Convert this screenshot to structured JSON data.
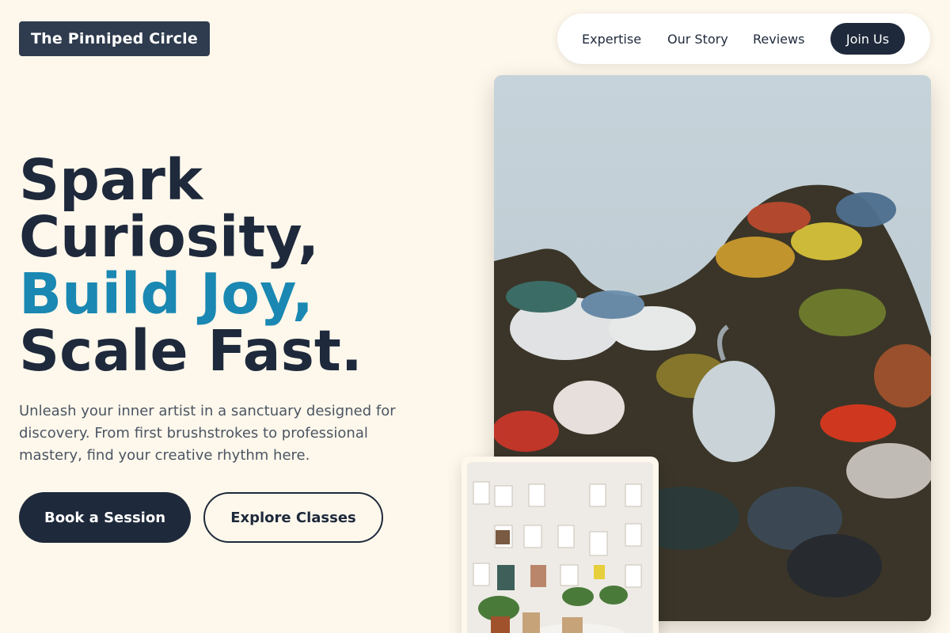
{
  "brand": {
    "name": "The Pinniped Circle"
  },
  "nav": {
    "links": [
      "Expertise",
      "Our Story",
      "Reviews"
    ],
    "cta": "Join Us"
  },
  "hero": {
    "title_line1": "Spark",
    "title_line2": "Curiosity,",
    "title_line3": "Build Joy,",
    "title_line4": "Scale Fast.",
    "subtitle": "Unleash your inner artist in a sanctuary designed for discovery. From first brushstrokes to professional mastery, find your creative rhythm here.",
    "primary_button": "Book a Session",
    "secondary_button": "Explore Classes"
  },
  "images": {
    "main": "paint-palette-photo",
    "secondary": "art-wall-studio-photo"
  },
  "colors": {
    "background": "#fef8ec",
    "navy": "#1e293b",
    "accent": "#1a88b2",
    "logo_bg": "#2f3b4e"
  }
}
